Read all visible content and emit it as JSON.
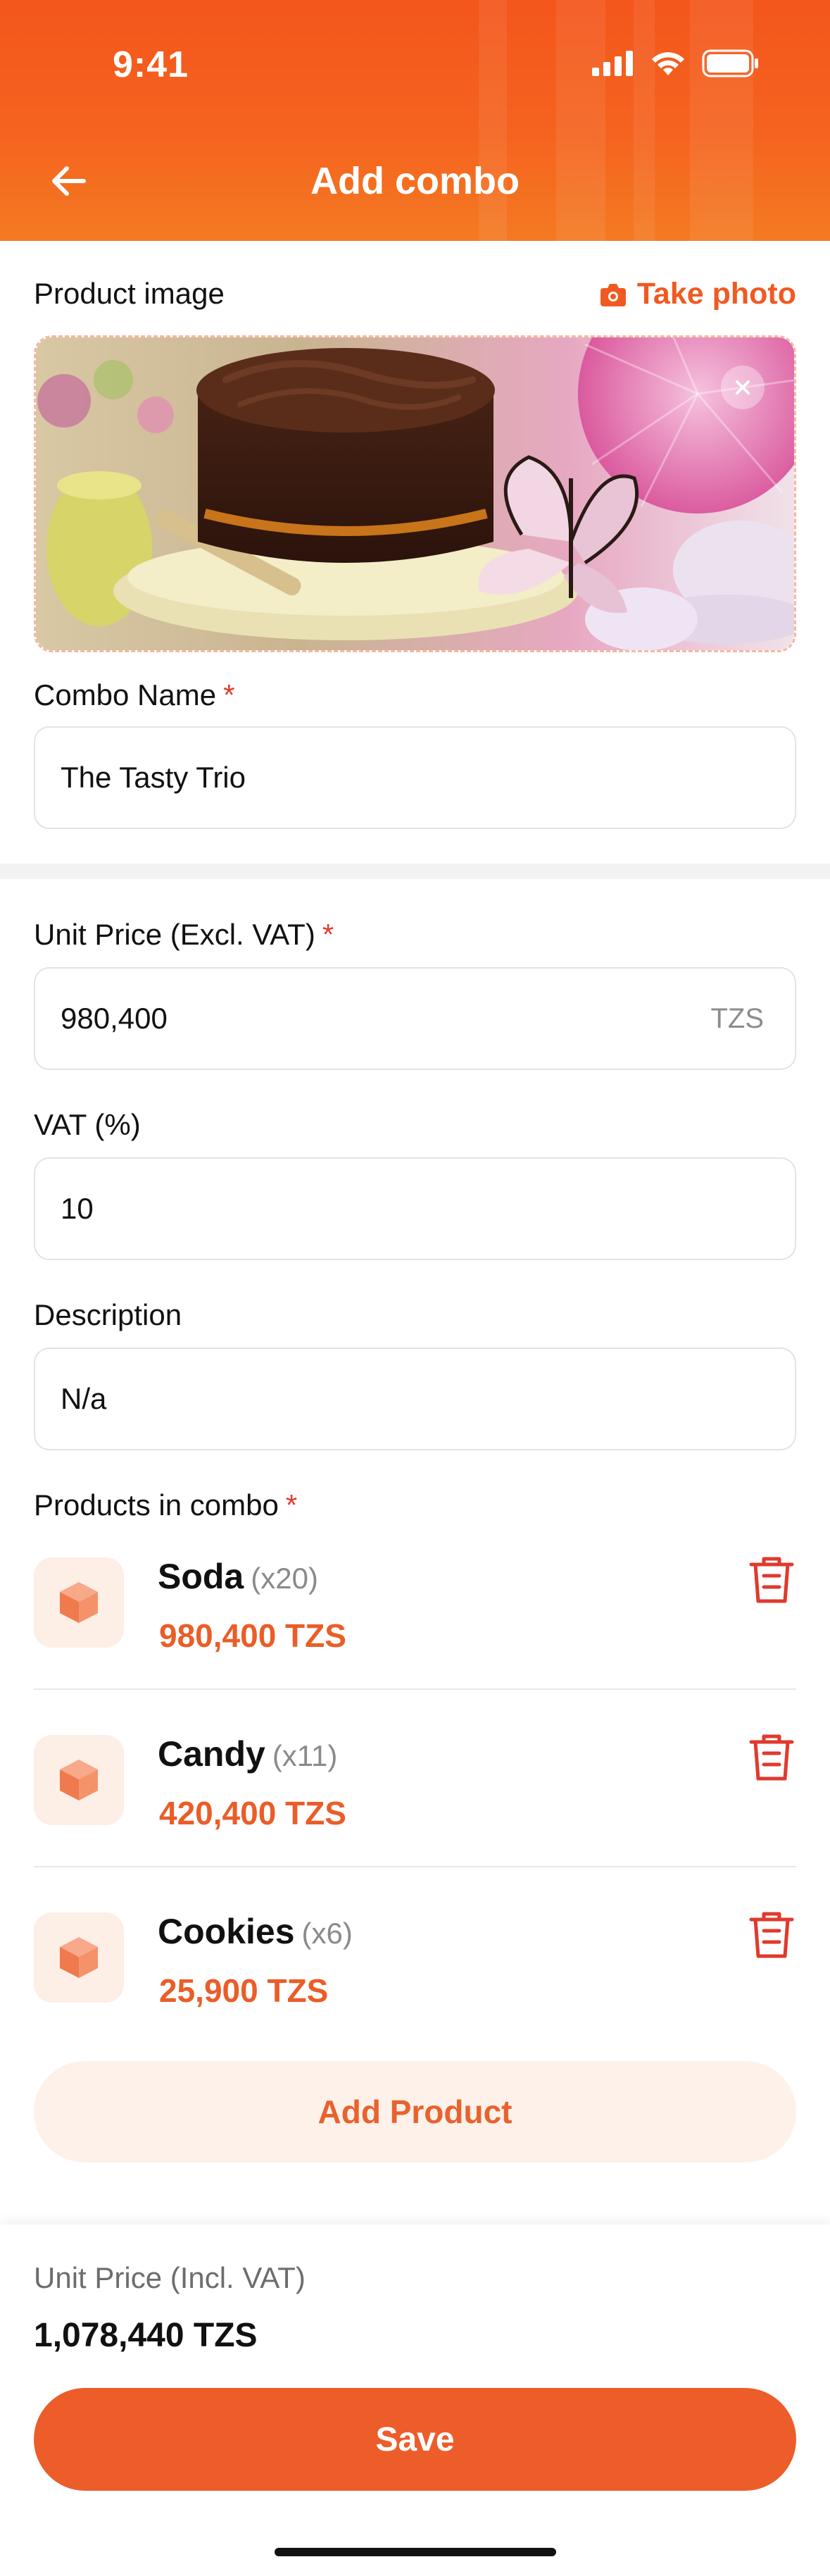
{
  "status_bar": {
    "time": "9:41"
  },
  "header": {
    "title": "Add combo"
  },
  "image_section": {
    "label": "Product image",
    "take_photo_label": "Take photo"
  },
  "combo_name": {
    "label": "Combo Name",
    "required_mark": "*",
    "value": "The Tasty Trio"
  },
  "unit_price": {
    "label": "Unit Price (Excl. VAT)",
    "required_mark": "*",
    "value": "980,400",
    "currency": "TZS"
  },
  "vat": {
    "label": "VAT (%)",
    "value": "10"
  },
  "description": {
    "label": "Description",
    "value": "N/a"
  },
  "products": {
    "label": "Products in combo",
    "required_mark": "*",
    "items": [
      {
        "name": "Soda",
        "qty": "(x20)",
        "price": "980,400 TZS"
      },
      {
        "name": "Candy",
        "qty": "(x11)",
        "price": "420,400 TZS"
      },
      {
        "name": "Cookies",
        "qty": "(x6)",
        "price": "25,900 TZS"
      }
    ],
    "add_button_label": "Add Product"
  },
  "footer": {
    "total_label": "Unit Price (Incl. VAT)",
    "total_value": "1,078,440 TZS",
    "save_label": "Save"
  },
  "colors": {
    "brand": "#f4561b",
    "accent_text": "#ea5d28",
    "danger": "#e03a2e",
    "soft_bg": "#fdf1ea"
  },
  "icons": {
    "back": "arrow-left-icon",
    "camera": "camera-icon",
    "remove": "close-icon",
    "product": "box-icon",
    "delete": "trash-icon"
  }
}
